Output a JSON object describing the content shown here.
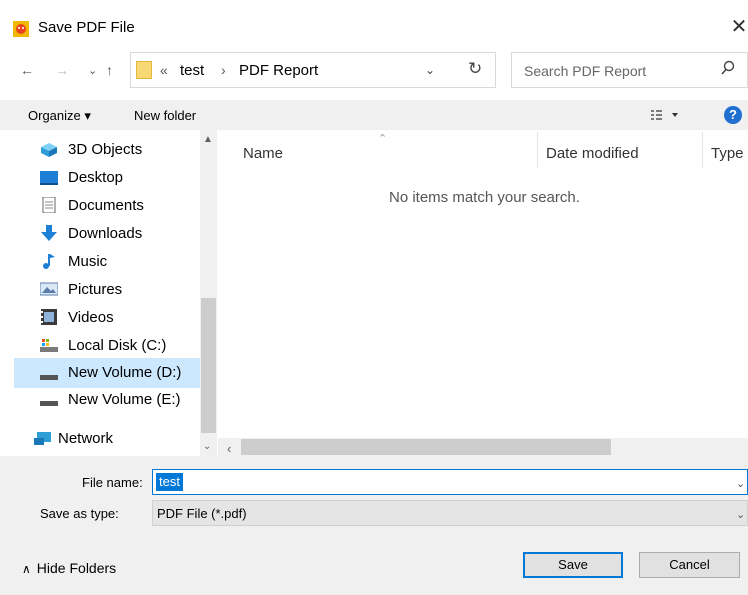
{
  "window": {
    "title": "Save PDF File",
    "close_glyph": "✕"
  },
  "nav": {
    "back_glyph": "←",
    "forward_glyph": "→",
    "recent_glyph": "⌄",
    "up_glyph": "↑",
    "breadcrumb": {
      "overflow": "«",
      "items": [
        "test",
        "PDF Report"
      ],
      "separator": "›"
    },
    "dropdown_glyph": "⌄",
    "refresh_glyph": "↻",
    "search_placeholder": "Search PDF Report"
  },
  "toolbar": {
    "organize_label": "Organize ▾",
    "new_folder_label": "New folder",
    "help_glyph": "?"
  },
  "sidebar": {
    "items": [
      {
        "label": "3D Objects",
        "icon": "3d-objects-icon"
      },
      {
        "label": "Desktop",
        "icon": "desktop-icon"
      },
      {
        "label": "Documents",
        "icon": "documents-icon"
      },
      {
        "label": "Downloads",
        "icon": "downloads-icon"
      },
      {
        "label": "Music",
        "icon": "music-icon"
      },
      {
        "label": "Pictures",
        "icon": "pictures-icon"
      },
      {
        "label": "Videos",
        "icon": "videos-icon"
      },
      {
        "label": "Local Disk (C:)",
        "icon": "local-disk-icon"
      },
      {
        "label": "New Volume (D:)",
        "icon": "drive-icon",
        "selected": true
      },
      {
        "label": "New Volume (E:)",
        "icon": "drive-icon"
      },
      {
        "label": "Network",
        "icon": "network-icon"
      }
    ]
  },
  "file_list": {
    "columns": [
      "Name",
      "Date modified",
      "Type"
    ],
    "empty_message": "No items match your search."
  },
  "form": {
    "file_name_label": "File name:",
    "file_name_value": "test",
    "save_as_type_label": "Save as type:",
    "save_as_type_value": "PDF File (*.pdf)"
  },
  "footer": {
    "hide_folders_label": "Hide Folders",
    "hide_folders_glyph": "∧",
    "save_label": "Save",
    "cancel_label": "Cancel"
  },
  "colors": {
    "accent": "#0078d7",
    "selection": "#cce8ff",
    "toolbar_bg": "#f0f0f0",
    "folder": "#f8d775"
  }
}
